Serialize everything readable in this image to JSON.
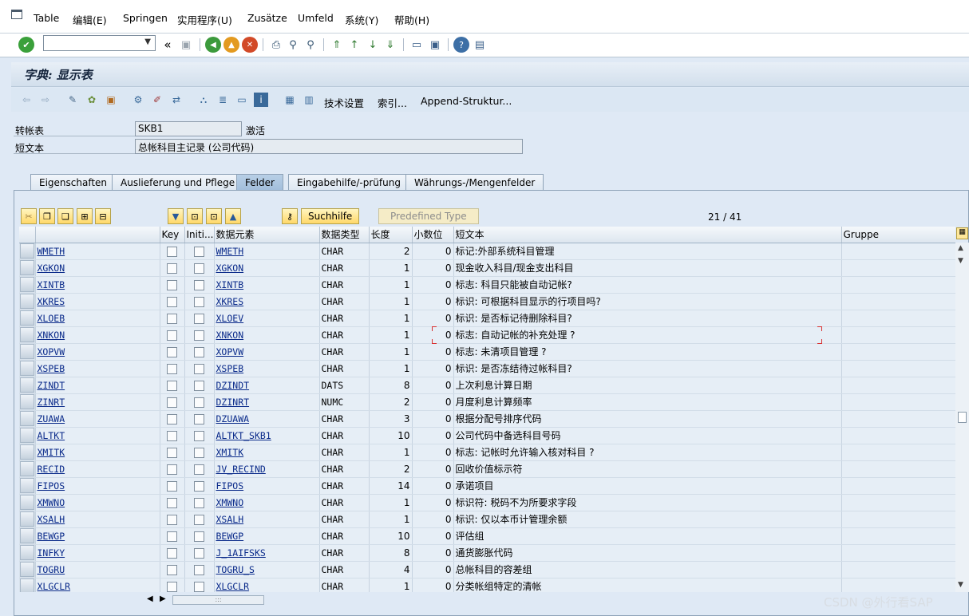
{
  "menu": [
    "Table",
    "编辑(E)",
    "Springen",
    "实用程序(U)",
    "Zusätze",
    "Umfeld",
    "系统(Y)",
    "帮助(H)"
  ],
  "title": "字典: 显示表",
  "app_toolbar": {
    "tech_settings": "技术设置",
    "index": "索引...",
    "append": "Append-Struktur..."
  },
  "header": {
    "table_label": "转帐表",
    "table_value": "SKB1",
    "status": "激活",
    "short_label": "短文本",
    "short_value": "总帐科目主记录 (公司代码)"
  },
  "tabs": [
    "Eigenschaften",
    "Auslieferung und Pflege",
    "Felder",
    "Eingabehilfe/-prüfung",
    "Währungs-/Mengenfelder"
  ],
  "buttons": {
    "search_help": "Suchhilfe",
    "predefined": "Predefined Type"
  },
  "pager": "21  /  41",
  "columns": [
    "",
    "",
    "Key",
    "Initi...",
    "数据元素",
    "数据类型",
    "长度",
    "小数位",
    "短文本",
    "Gruppe"
  ],
  "rows": [
    [
      "WMETH",
      "WMETH",
      "CHAR",
      "2",
      "0",
      "标记:外部系统科目管理"
    ],
    [
      "XGKON",
      "XGKON",
      "CHAR",
      "1",
      "0",
      "现金收入科目/现金支出科目"
    ],
    [
      "XINTB",
      "XINTB",
      "CHAR",
      "1",
      "0",
      "标志: 科目只能被自动记帐?"
    ],
    [
      "XKRES",
      "XKRES",
      "CHAR",
      "1",
      "0",
      "标识: 可根据科目显示的行项目吗?"
    ],
    [
      "XLOEB",
      "XLOEV",
      "CHAR",
      "1",
      "0",
      "标识: 是否标记待删除科目?"
    ],
    [
      "XNKON",
      "XNKON",
      "CHAR",
      "1",
      "0",
      "标志: 自动记帐的补充处理 ?"
    ],
    [
      "XOPVW",
      "XOPVW",
      "CHAR",
      "1",
      "0",
      "标志: 未清项目管理 ?"
    ],
    [
      "XSPEB",
      "XSPEB",
      "CHAR",
      "1",
      "0",
      "标识: 是否冻结待过帐科目?"
    ],
    [
      "ZINDT",
      "DZINDT",
      "DATS",
      "8",
      "0",
      "上次利息计算日期"
    ],
    [
      "ZINRT",
      "DZINRT",
      "NUMC",
      "2",
      "0",
      "月度利息计算频率"
    ],
    [
      "ZUAWA",
      "DZUAWA",
      "CHAR",
      "3",
      "0",
      "根据分配号排序代码"
    ],
    [
      "ALTKT",
      "ALTKT_SKB1",
      "CHAR",
      "10",
      "0",
      "公司代码中备选科目号码"
    ],
    [
      "XMITK",
      "XMITK",
      "CHAR",
      "1",
      "0",
      "标志: 记帐时允许输入核对科目 ?"
    ],
    [
      "RECID",
      "JV_RECIND",
      "CHAR",
      "2",
      "0",
      "回收价值标示符"
    ],
    [
      "FIPOS",
      "FIPOS",
      "CHAR",
      "14",
      "0",
      "承诺项目"
    ],
    [
      "XMWNO",
      "XMWNO",
      "CHAR",
      "1",
      "0",
      "标识符: 税码不为所要求字段"
    ],
    [
      "XSALH",
      "XSALH",
      "CHAR",
      "1",
      "0",
      "标识: 仅以本币计管理余额"
    ],
    [
      "BEWGP",
      "BEWGP",
      "CHAR",
      "10",
      "0",
      "评估组"
    ],
    [
      "INFKY",
      "J_1AIFSKS",
      "CHAR",
      "8",
      "0",
      "通货膨胀代码"
    ],
    [
      "TOGRU",
      "TOGRU_S",
      "CHAR",
      "4",
      "0",
      "总帐科目的容差组"
    ],
    [
      "XLGCLR",
      "XLGCLR",
      "CHAR",
      "1",
      "0",
      "分类帐组特定的清帐"
    ]
  ],
  "watermark": "CSDN @外行看SAP"
}
